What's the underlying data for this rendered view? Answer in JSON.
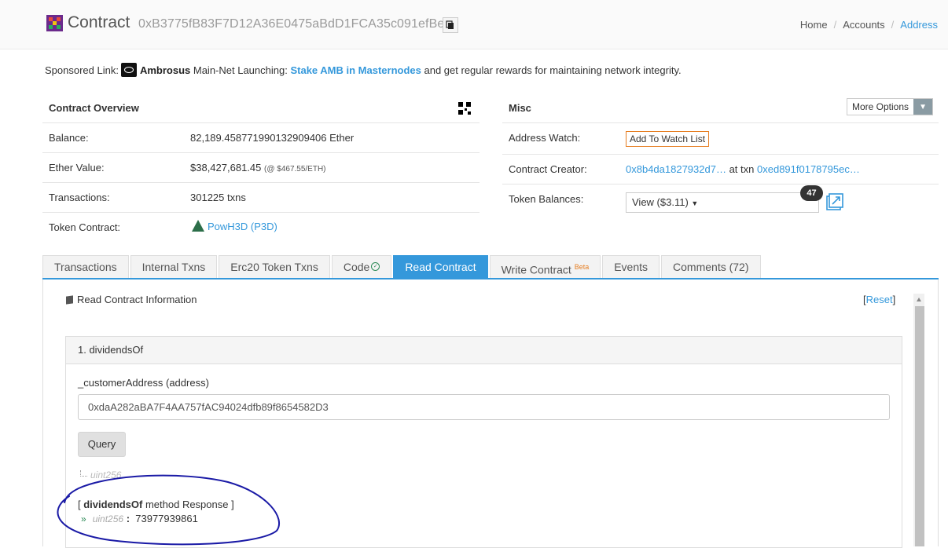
{
  "header": {
    "title": "Contract",
    "address": "0xB3775fB83F7D12A36E0475aBdD1FCA35c091efBe",
    "breadcrumb": [
      "Home",
      "Accounts",
      "Address"
    ]
  },
  "sponsor": {
    "prefix": "Sponsored Link:",
    "brand": "Ambrosus",
    "text1": "Main-Net Launching:",
    "link": "Stake AMB in Masternodes",
    "text2": "and get regular rewards for maintaining network integrity."
  },
  "overview": {
    "title": "Contract Overview",
    "rows": [
      {
        "label": "Balance:",
        "value": "82,189.458771990132909406 Ether"
      },
      {
        "label": "Ether Value:",
        "value": "$38,427,681.45",
        "note": "(@ $467.55/ETH)"
      },
      {
        "label": "Transactions:",
        "value": "301225 txns"
      },
      {
        "label": "Token Contract:",
        "value": "PowH3D (P3D)"
      }
    ]
  },
  "misc": {
    "title": "Misc",
    "more_options": "More Options",
    "address_watch_label": "Address Watch:",
    "watch_button": "Add To Watch List",
    "creator_label": "Contract Creator:",
    "creator_address": "0x8b4da1827932d7…",
    "creator_at": "at txn",
    "creator_txn": "0xed891f0178795ec…",
    "token_balances_label": "Token Balances:",
    "token_view": "View ($3.11)",
    "token_count": "47"
  },
  "tabs": [
    {
      "label": "Transactions"
    },
    {
      "label": "Internal Txns"
    },
    {
      "label": "Erc20 Token Txns"
    },
    {
      "label": "Code"
    },
    {
      "label": "Read Contract"
    },
    {
      "label": "Write Contract",
      "sup": "Beta"
    },
    {
      "label": "Events"
    },
    {
      "label": "Comments (72)"
    }
  ],
  "read_contract": {
    "title": "Read Contract Information",
    "reset": "Reset",
    "method": {
      "name": "1. dividendsOf",
      "param_label": "_customerAddress (address)",
      "param_value": "0xdaA282aBA7F4AA757fAC94024dfb89f8654582D3",
      "query_button": "Query",
      "output_type": "uint256",
      "response_prefix": "[ ",
      "response_method": "dividendsOf",
      "response_suffix": " method Response ]",
      "response_type": "uint256",
      "response_value": "73977939861"
    }
  },
  "colors": {
    "accent": "#3498db",
    "annotation": "#1a1aa6"
  }
}
